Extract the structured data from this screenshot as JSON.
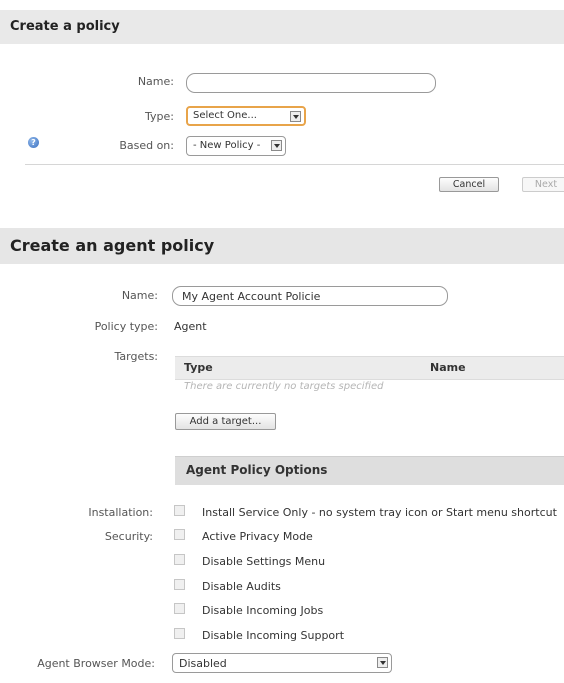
{
  "create_policy": {
    "title": "Create a policy",
    "name_label": "Name:",
    "name_value": "",
    "type_label": "Type:",
    "type_value": "Select One...",
    "based_on_label": "Based on:",
    "based_on_value": "- New Policy -",
    "cancel_label": "Cancel",
    "next_label": "Next"
  },
  "agent_policy": {
    "title": "Create an agent policy",
    "name_label": "Name:",
    "name_value": "My Agent Account Policie",
    "policy_type_label": "Policy type:",
    "policy_type_value": "Agent",
    "targets_label": "Targets:",
    "targets_columns": [
      "Type",
      "Name"
    ],
    "targets_empty": "There are currently no targets specified",
    "add_target_label": "Add a target...",
    "options_title": "Agent Policy Options",
    "installation_label": "Installation:",
    "security_label": "Security:",
    "options": [
      {
        "label": "Install Service Only - no system tray icon or Start menu shortcut",
        "checked": false
      },
      {
        "label": "Active Privacy Mode",
        "checked": false
      },
      {
        "label": "Disable Settings Menu",
        "checked": false
      },
      {
        "label": "Disable Audits",
        "checked": false
      },
      {
        "label": "Disable Incoming Jobs",
        "checked": false
      },
      {
        "label": "Disable Incoming Support",
        "checked": false
      }
    ],
    "browser_mode_label": "Agent Browser Mode:",
    "browser_mode_value": "Disabled"
  }
}
